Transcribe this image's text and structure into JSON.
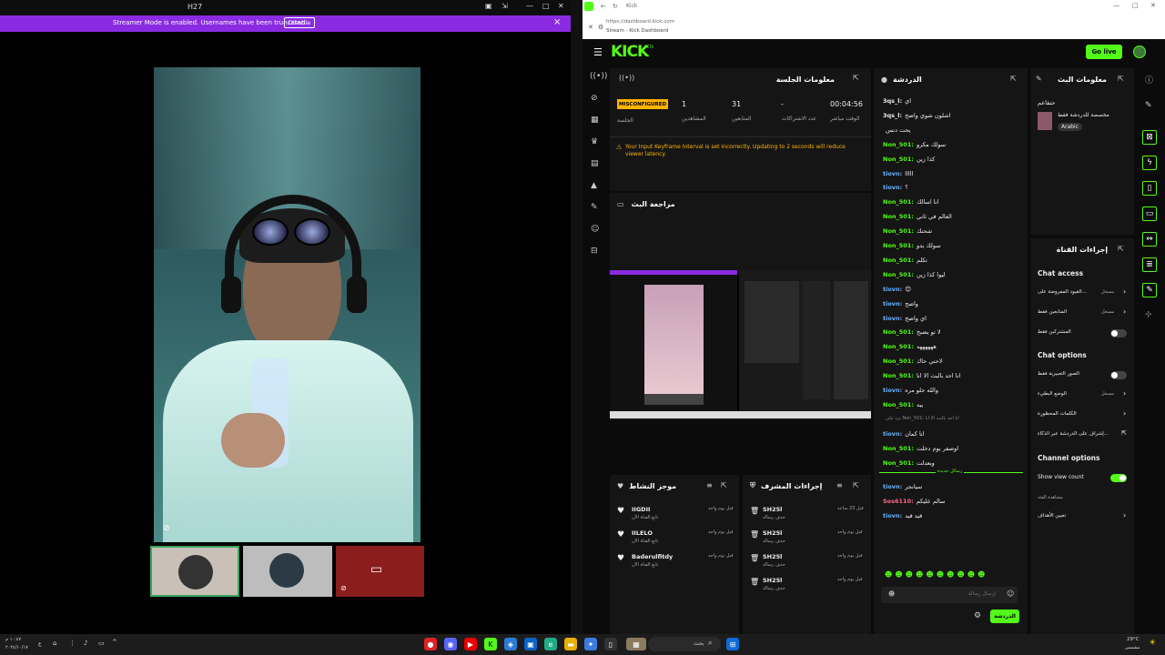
{
  "left_window": {
    "title": "H27",
    "streamer_banner": "Streamer Mode is enabled. Usernames have been truncated.",
    "disable_label": "Disable",
    "close_glyph": "×",
    "tile_labels": [
      "",
      "",
      ""
    ]
  },
  "browser": {
    "url": "https://dashboard.kick.com",
    "tab_title": "Stream - Kick Dashboard",
    "page_tab": "Kick"
  },
  "kick": {
    "logo": "KICK",
    "logo_sup": "BETA",
    "go_live": "Go live"
  },
  "session": {
    "title": "معلومات الجلسة",
    "status_badge": "MISCONFIGURED",
    "status_label": "الجلسة",
    "stats": [
      {
        "value": "1",
        "label": "المشاهدين"
      },
      {
        "value": "31",
        "label": "المتابعين"
      },
      {
        "value": "-",
        "label": "عدد الاشتراكات"
      },
      {
        "value": "00:04:56",
        "label": "الوقت مباشر"
      }
    ],
    "warning": "Your Input Keyframe Interval is set incorrectly. Updating to 2 seconds will reduce viewer latency."
  },
  "preview": {
    "title": "مراجعة البث"
  },
  "chat": {
    "title": "الدردشة",
    "messages": [
      {
        "user": "3qs_l:",
        "text": "اي",
        "color": "white"
      },
      {
        "user": "3qs_l:",
        "text": "اشلون شوي واضح",
        "color": "white"
      },
      {
        "user": "",
        "text": "يحت دنس",
        "color": "white"
      },
      {
        "user": "Non_501:",
        "text": "سولك مكرو",
        "color": "green"
      },
      {
        "user": "Non_501:",
        "text": "كذا زين",
        "color": "green"
      },
      {
        "user": "tiovn:",
        "text": "lllll",
        "color": "blue"
      },
      {
        "user": "tiovn:",
        "text": "؟",
        "color": "blue"
      },
      {
        "user": "Non_501:",
        "text": "انا اسالك",
        "color": "green"
      },
      {
        "user": "Non_501:",
        "text": "العالم في ثاني",
        "color": "green"
      },
      {
        "user": "Non_501:",
        "text": "شحنك",
        "color": "green"
      },
      {
        "user": "Non_501:",
        "text": "سولك بدو",
        "color": "green"
      },
      {
        "user": "Non_501:",
        "text": "تكلم",
        "color": "green"
      },
      {
        "user": "Non_501:",
        "text": "ليوا كذا زين",
        "color": "green"
      },
      {
        "user": "tiovn:",
        "text": "😊",
        "color": "blue"
      },
      {
        "user": "tiovn:",
        "text": "واضح",
        "color": "blue"
      },
      {
        "user": "tiovn:",
        "text": "اي واضح",
        "color": "blue"
      },
      {
        "user": "Non_501:",
        "text": "لا تو يضبح",
        "color": "green"
      },
      {
        "user": "Non_501:",
        "text": "ههههههه",
        "color": "green"
      },
      {
        "user": "Non_501:",
        "text": "لاحني حاك",
        "color": "green"
      },
      {
        "user": "Non_501:",
        "text": "انا احد بالبث الا انا",
        "color": "green"
      },
      {
        "user": "tiovn:",
        "text": "والله حلو مره",
        "color": "blue"
      },
      {
        "user": "Non_501:",
        "text": "يبه",
        "color": "green"
      },
      {
        "user": "",
        "text": "ترد على Non_501: انا احد بالبث الا انا",
        "color": "grey"
      },
      {
        "user": "tiovn:",
        "text": "انا كمان",
        "color": "blue"
      },
      {
        "user": "Non_501:",
        "text": "اوصفر يوم دخلت",
        "color": "green"
      },
      {
        "user": "Non_501:",
        "text": "ويعدلت",
        "color": "green"
      }
    ],
    "new_messages": "رسائل جديدة",
    "new": [
      {
        "user": "tiovn:",
        "text": "سيانجر",
        "color": "blue"
      },
      {
        "user": "Sos6110:",
        "text": "سالم عليكم",
        "color": "pink"
      },
      {
        "user": "tiovn:",
        "text": "قيد قيد",
        "color": "blue"
      }
    ],
    "input_placeholder": "إرسال رسالة",
    "send_label": "الدردشة"
  },
  "stream_info": {
    "title": "معلومات البث",
    "name": "حنقاعم",
    "category": "مخصصة للدردشة فقط",
    "language": "Arabic"
  },
  "channel_actions": {
    "title": "إجراءات القناة",
    "chat_access": "Chat access",
    "chat_options": "Chat options",
    "channel_options": "Channel options",
    "rows_access": [
      {
        "label": "القيود المفروضة على...",
        "value": "مسحل"
      },
      {
        "label": "المتابعين فقط",
        "value": "مسحل"
      },
      {
        "label": "المشتركين فقط",
        "value": ""
      }
    ],
    "rows_options": [
      {
        "label": "الصور التعبيرية فقط",
        "value": ""
      },
      {
        "label": "الوضع البطيء",
        "value": "مسحل"
      },
      {
        "label": "الكلمات المحظورة",
        "value": ""
      },
      {
        "label": "إشراف على الدردشة عبر الذكاء...",
        "value": ""
      }
    ],
    "show_view_count": "Show view count",
    "goals_sub": "مشاهدة الفئة",
    "goals": "تعيين الأهداف"
  },
  "activity": {
    "title": "موجز النشاط",
    "items": [
      {
        "name": "IIGDII",
        "sub": "تابع القناة الآن",
        "time": "قبل يوم واحد"
      },
      {
        "name": "IILELO",
        "sub": "تابع القناة الآن",
        "time": "قبل يوم واحد"
      },
      {
        "name": "Baderulfitdy",
        "sub": "تابع القناة الآن",
        "time": "قبل يوم واحد"
      }
    ]
  },
  "mod_actions": {
    "title": "إجراءات المشرف",
    "items": [
      {
        "name": "SH25l",
        "sub": "حذف رسالة",
        "time": "قبل 23 ساعة"
      },
      {
        "name": "SH25l",
        "sub": "حذف رسالة",
        "time": "قبل يوم واحد"
      },
      {
        "name": "SH25l",
        "sub": "حذف رسالة",
        "time": "قبل يوم واحد"
      },
      {
        "name": "SH25l",
        "sub": "حذف رسالة",
        "time": "قبل يوم واحد"
      }
    ]
  },
  "taskbar": {
    "search_placeholder": "بحث",
    "weather": "29°C",
    "weather_sub": "مشمس",
    "time": "١٠:٤٧ م",
    "date": "٢٠٢٤/١٠/١٧",
    "lang": "ع"
  },
  "colors": {
    "kick_green": "#53fc18",
    "banner_purple": "#8a2be2",
    "warning_yellow": "#ffb400"
  }
}
